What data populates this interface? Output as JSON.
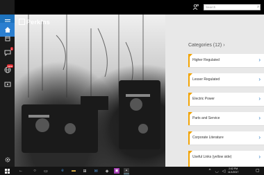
{
  "search": {
    "placeholder": "Search"
  },
  "brand": {
    "logo_text": "Perkins"
  },
  "sidebar": {
    "items": [
      {
        "name": "menu",
        "icon": "hamburger-icon",
        "active": true
      },
      {
        "name": "home",
        "icon": "home-icon"
      },
      {
        "name": "products",
        "icon": "box-icon"
      },
      {
        "name": "messages",
        "icon": "chat-icon",
        "badge": "1"
      },
      {
        "name": "web",
        "icon": "globe-icon",
        "badge": "new"
      },
      {
        "name": "video",
        "icon": "video-icon"
      },
      {
        "name": "settings",
        "icon": "gear-icon"
      }
    ]
  },
  "categories": {
    "title": "Categories (12)",
    "items": [
      "Higher Regulated",
      "Lesser Regulated",
      "Electric Power",
      "Parts and Service",
      "Corporate Literature",
      "Useful Links (yellow side)"
    ]
  },
  "taskbar": {
    "time": "2:02 PM",
    "date": "11/1/2017",
    "colors": {
      "accent": "#1e73be",
      "category_stripe": "#f2a300"
    }
  }
}
